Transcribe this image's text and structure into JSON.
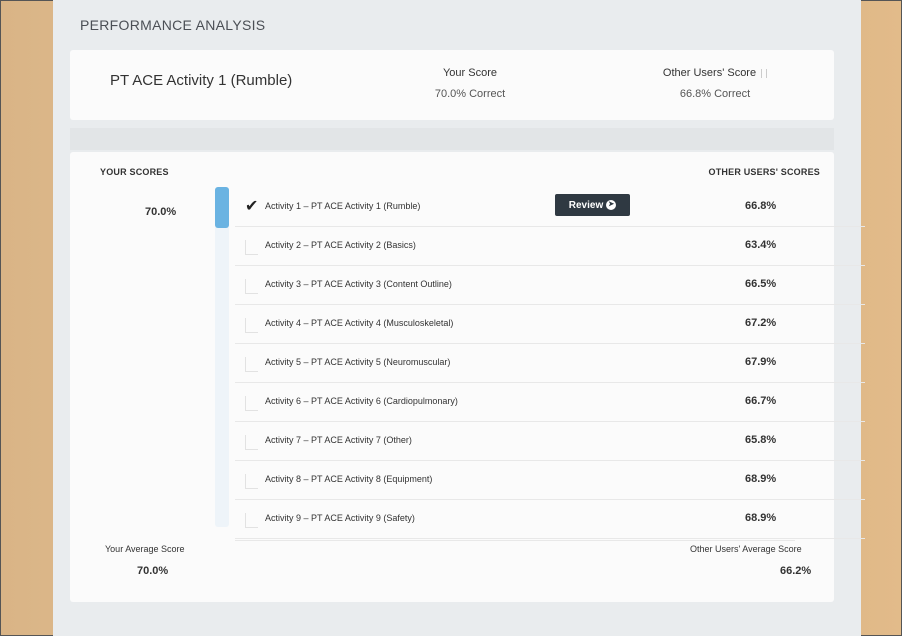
{
  "header": {
    "title": "PERFORMANCE ANALYSIS"
  },
  "summary": {
    "activity_name": "PT ACE Activity 1 (Rumble)",
    "your_score_label": "Your Score",
    "your_score_value": "70.0% Correct",
    "other_score_label": "Other Users' Score",
    "other_score_value": "66.8% Correct"
  },
  "scores": {
    "your_scores_header": "YOUR SCORES",
    "other_scores_header": "OTHER USERS' SCORES",
    "your_current_value": "70.0%",
    "progress_fraction": 0.12,
    "review_label": "Review",
    "rows": [
      {
        "label": "Activity 1 – PT ACE Activity 1 (Rumble)",
        "other_score": "66.8%",
        "checked": true
      },
      {
        "label": "Activity 2 – PT ACE Activity 2 (Basics)",
        "other_score": "63.4%",
        "checked": false
      },
      {
        "label": "Activity 3 – PT ACE Activity 3 (Content Outline)",
        "other_score": "66.5%",
        "checked": false
      },
      {
        "label": "Activity 4 – PT ACE Activity 4 (Musculoskeletal)",
        "other_score": "67.2%",
        "checked": false
      },
      {
        "label": "Activity 5 – PT ACE Activity 5 (Neuromuscular)",
        "other_score": "67.9%",
        "checked": false
      },
      {
        "label": "Activity 6 – PT ACE Activity 6 (Cardiopulmonary)",
        "other_score": "66.7%",
        "checked": false
      },
      {
        "label": "Activity 7 – PT ACE Activity 7 (Other)",
        "other_score": "65.8%",
        "checked": false
      },
      {
        "label": "Activity 8 – PT ACE Activity 8 (Equipment)",
        "other_score": "68.9%",
        "checked": false
      },
      {
        "label": "Activity 9 – PT ACE Activity 9 (Safety)",
        "other_score": "68.9%",
        "checked": false
      }
    ]
  },
  "averages": {
    "your_label": "Your Average Score",
    "your_value": "70.0%",
    "other_label": "Other Users' Average Score",
    "other_value": "66.2%"
  }
}
